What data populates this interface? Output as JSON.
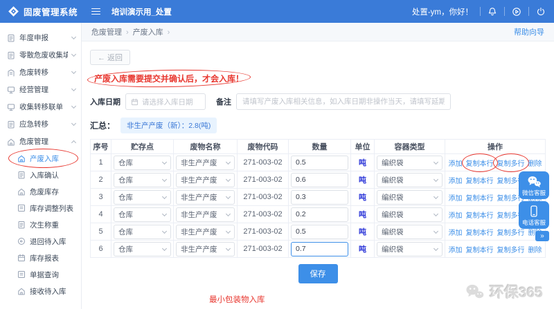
{
  "colors": {
    "header_bg": "#3a7bd8",
    "accent": "#3d8fe8",
    "link": "#3d8fe8",
    "danger": "#e8372f",
    "unit_text": "#2b35d8",
    "badge_bg": "#e8f3fe",
    "badge_text": "#3a78d6"
  },
  "header": {
    "app_title": "固废管理系统",
    "tab": "培训演示用_处置",
    "greeting": "处置-ym，你好！"
  },
  "sidebar": {
    "items": [
      {
        "name": "annual-report",
        "label": "年度申报",
        "icon": "document-icon",
        "expanded": false
      },
      {
        "name": "scattered-hw-collection",
        "label": "零散危废收集填报",
        "icon": "document-icon",
        "expanded": false
      },
      {
        "name": "hw-transfer",
        "label": "危废转移",
        "icon": "building-icon",
        "expanded": false
      },
      {
        "name": "operation-management",
        "label": "经营管理",
        "icon": "monitor-icon",
        "expanded": false
      },
      {
        "name": "collection-transfer-manifest",
        "label": "收集转移联单",
        "icon": "monitor-icon",
        "expanded": false
      },
      {
        "name": "emergency-transfer",
        "label": "应急转移",
        "icon": "document-icon",
        "expanded": false
      },
      {
        "name": "hw-management",
        "label": "危废管理",
        "icon": "house-icon",
        "expanded": true
      }
    ],
    "subitems": [
      {
        "name": "waste-inbound",
        "label": "产废入库",
        "icon": "house-icon",
        "active": true,
        "circled": true
      },
      {
        "name": "inbound-confirm",
        "label": "入库确认",
        "icon": "document-icon",
        "active": false,
        "circled": false
      },
      {
        "name": "hw-inventory",
        "label": "危废库存",
        "icon": "house-icon",
        "active": false,
        "circled": false
      },
      {
        "name": "inventory-adjust-list",
        "label": "库存调整列表",
        "icon": "list-icon",
        "active": false,
        "circled": false
      },
      {
        "name": "secondary-weighing",
        "label": "次生称重",
        "icon": "document-icon",
        "active": false,
        "circled": false
      },
      {
        "name": "return-pending-inbound",
        "label": "退回待入库",
        "icon": "back-circle-icon",
        "active": false,
        "circled": false
      },
      {
        "name": "inventory-report",
        "label": "库存报表",
        "icon": "calendar-icon",
        "active": false,
        "circled": false
      },
      {
        "name": "document-query",
        "label": "单据查询",
        "icon": "list-icon",
        "active": false,
        "circled": false
      },
      {
        "name": "receive-pending-inbound",
        "label": "接收待入库",
        "icon": "house-icon",
        "active": false,
        "circled": false
      }
    ]
  },
  "breadcrumb": {
    "items": [
      "危废管理",
      "产废入库"
    ],
    "separator": "›",
    "help_link": "帮助向导"
  },
  "toolbar": {
    "back_label": "← 返回"
  },
  "notice": "产废入库需要提交并确认后，才会入库！",
  "form": {
    "date_label": "入库日期",
    "date_placeholder": "请选择入库日期",
    "remark_label": "备注",
    "remark_placeholder": "请填写产废入库相关信息，如入库日期非操作当天，请填写延期入库原因"
  },
  "summary": {
    "label": "汇总：",
    "badge": "非生产产废（新）：2.8(吨)"
  },
  "table": {
    "headers": [
      "序号",
      "贮存点",
      "废物名称",
      "废物代码",
      "数量",
      "单位",
      "容器类型",
      "操作"
    ],
    "action_labels": [
      "添加",
      "复制本行",
      "复制多行",
      "删除"
    ],
    "rows": [
      {
        "no": "1",
        "storage": "仓库",
        "waste_name": "非生产产废",
        "waste_code": "271-003-02",
        "qty": "0.5",
        "unit": "吨",
        "container": "编织袋",
        "circled_actions": true,
        "focused": false
      },
      {
        "no": "2",
        "storage": "仓库",
        "waste_name": "非生产产废",
        "waste_code": "271-003-02",
        "qty": "0.6",
        "unit": "吨",
        "container": "编织袋",
        "circled_actions": false,
        "focused": false
      },
      {
        "no": "3",
        "storage": "仓库",
        "waste_name": "非生产产废",
        "waste_code": "271-003-02",
        "qty": "0.3",
        "unit": "吨",
        "container": "编织袋",
        "circled_actions": false,
        "focused": false
      },
      {
        "no": "4",
        "storage": "仓库",
        "waste_name": "非生产产废",
        "waste_code": "271-003-02",
        "qty": "0.2",
        "unit": "吨",
        "container": "编织袋",
        "circled_actions": false,
        "focused": false
      },
      {
        "no": "5",
        "storage": "仓库",
        "waste_name": "非生产产废",
        "waste_code": "271-003-02",
        "qty": "0.5",
        "unit": "吨",
        "container": "编织袋",
        "circled_actions": false,
        "focused": false
      },
      {
        "no": "6",
        "storage": "仓库",
        "waste_name": "非生产产废",
        "waste_code": "271-003-02",
        "qty": "0.7",
        "unit": "吨",
        "container": "编织袋",
        "circled_actions": false,
        "focused": true
      }
    ]
  },
  "footer": {
    "save_label": "保存",
    "note": "最小包装物入库",
    "watermark": "环保365"
  },
  "float_widget": {
    "wechat_label": "微信客服",
    "phone_label": "电话客服",
    "collapse": "»"
  }
}
